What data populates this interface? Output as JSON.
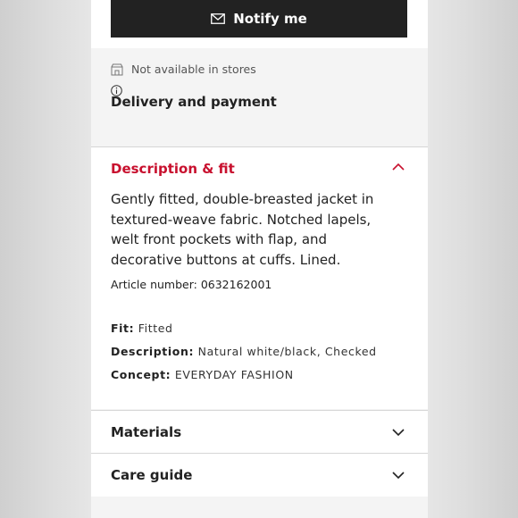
{
  "notify": {
    "label": "Notify me"
  },
  "store": {
    "status": "Not available in stores"
  },
  "delivery": {
    "label": "Delivery and payment"
  },
  "description": {
    "title": "Description & fit",
    "text": "Gently fitted, double-breasted jacket in textured-weave fabric. Notched lapels, welt front pockets with flap, and decorative buttons at cuffs. Lined.",
    "article": "Article number: 0632162001",
    "specs": [
      {
        "label": "Fit:",
        "value": "Fitted"
      },
      {
        "label": "Description:",
        "value": "Natural white/black, Checked"
      },
      {
        "label": "Concept:",
        "value": "EVERYDAY FASHION"
      }
    ]
  },
  "accordions": [
    {
      "label": "Materials"
    },
    {
      "label": "Care guide"
    }
  ],
  "colors": {
    "accent": "#c8102e",
    "button": "#222222"
  }
}
